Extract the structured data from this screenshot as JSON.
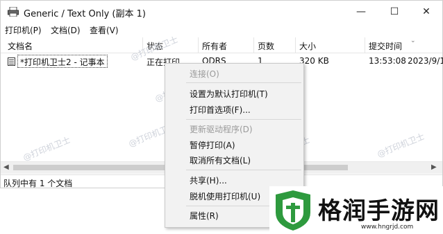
{
  "window": {
    "title": "Generic / Text Only (副本 1)",
    "min_symbol": "—",
    "max_symbol": "☐",
    "close_symbol": "✕"
  },
  "menubar": {
    "items": [
      "打印机(P)",
      "文档(D)",
      "查看(V)"
    ]
  },
  "columns": [
    "文档名",
    "状态",
    "所有者",
    "页数",
    "大小",
    "提交时间"
  ],
  "jobs": [
    {
      "name": "*打印机卫士2 - 记事本",
      "status": "正在打印",
      "owner": "ODRS",
      "pages": "1",
      "size": "320 KB",
      "time": "13:53:08",
      "date": "2023/9/1"
    }
  ],
  "statusbar": {
    "text": "队列中有 1 个文档"
  },
  "context_menu": {
    "items": [
      {
        "label": "连接(O)",
        "disabled": true
      },
      {
        "label": "设置为默认打印机(T)",
        "disabled": false
      },
      {
        "label": "打印首选项(F)...",
        "disabled": false
      },
      {
        "label": "更新驱动程序(D)",
        "disabled": true
      },
      {
        "label": "暂停打印(A)",
        "disabled": false
      },
      {
        "label": "取消所有文档(L)",
        "disabled": false
      },
      {
        "label": "共享(H)...",
        "disabled": false
      },
      {
        "label": "脱机使用打印机(U)",
        "disabled": false
      },
      {
        "label": "属性(R)",
        "disabled": false
      }
    ]
  },
  "watermark": {
    "text": "@打印机卫士"
  },
  "brand": {
    "name": "格润手游网",
    "url": "www.hngrjd.com",
    "green": "#2e9a3e"
  }
}
